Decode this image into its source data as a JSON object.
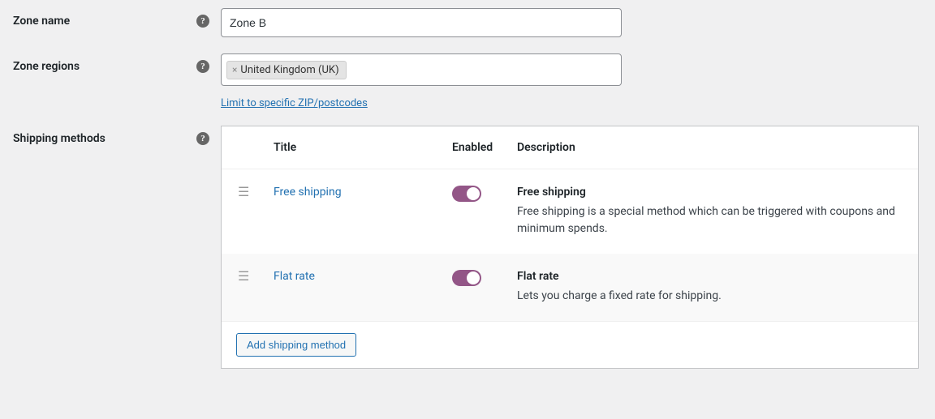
{
  "labels": {
    "zone_name": "Zone name",
    "zone_regions": "Zone regions",
    "shipping_methods": "Shipping methods"
  },
  "fields": {
    "zone_name_value": "Zone B",
    "region_tag": "United Kingdom (UK)",
    "limit_link": "Limit to specific ZIP/postcodes"
  },
  "table": {
    "headers": {
      "title": "Title",
      "enabled": "Enabled",
      "description": "Description"
    },
    "rows": [
      {
        "title": "Free shipping",
        "desc_title": "Free shipping",
        "desc_text": "Free shipping is a special method which can be triggered with coupons and minimum spends."
      },
      {
        "title": "Flat rate",
        "desc_title": "Flat rate",
        "desc_text": "Lets you charge a fixed rate for shipping."
      }
    ],
    "add_button": "Add shipping method"
  }
}
